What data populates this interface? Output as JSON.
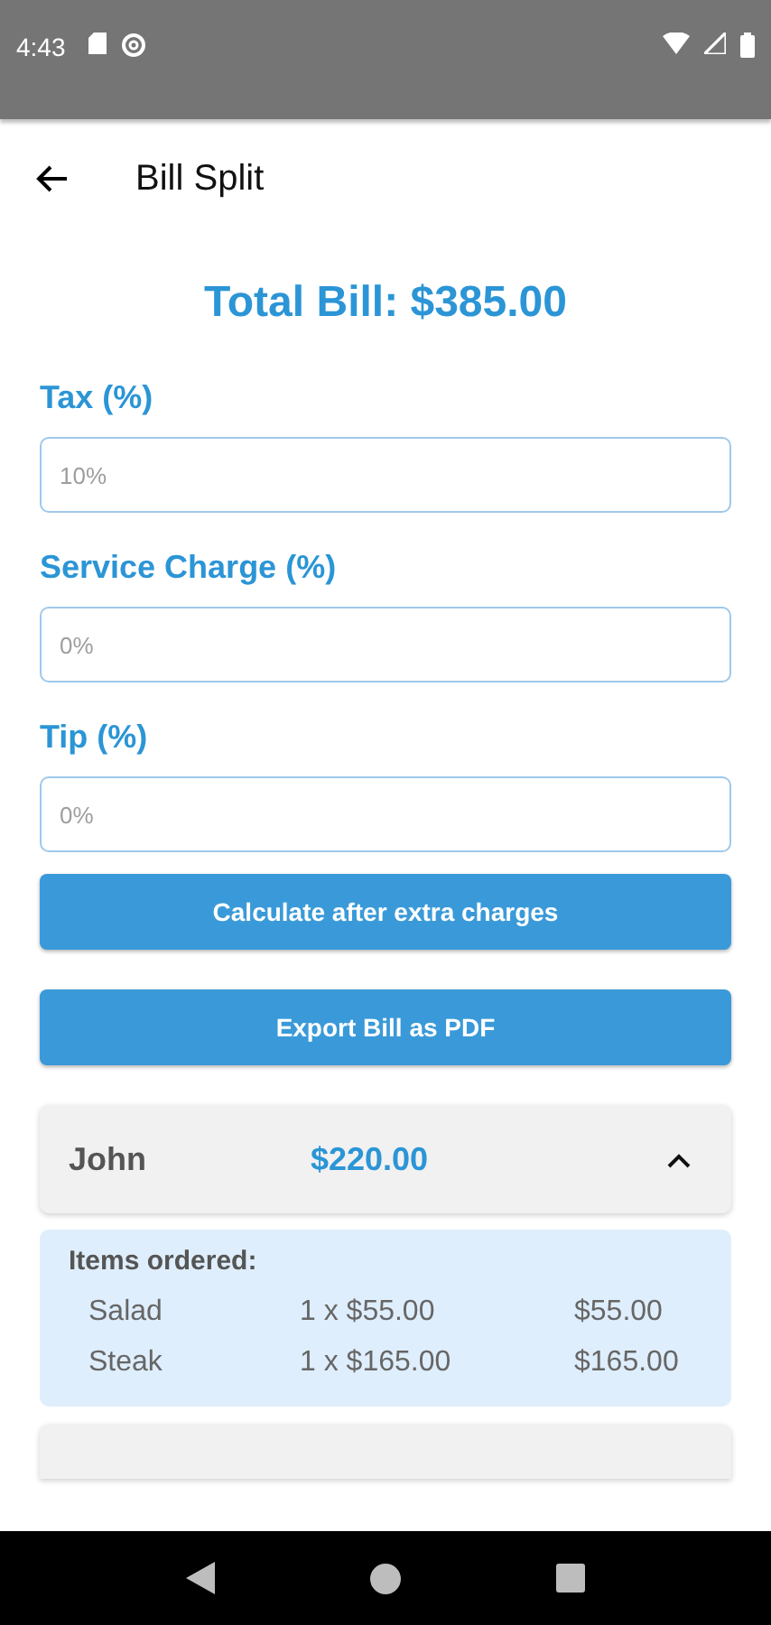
{
  "status_bar": {
    "time": "4:43"
  },
  "app_bar": {
    "title": "Bill Split"
  },
  "total": "Total Bill: $385.00",
  "fields": [
    {
      "label": "Tax (%)",
      "placeholder": "10%"
    },
    {
      "label": "Service Charge (%)",
      "placeholder": "0%"
    },
    {
      "label": "Tip (%)",
      "placeholder": "0%"
    }
  ],
  "buttons": [
    "Calculate after extra charges",
    "Export Bill as PDF"
  ],
  "people": [
    {
      "name": "John",
      "amount": "$220.00",
      "expanded": true,
      "items_heading": "Items ordered:",
      "items": [
        {
          "name": "Salad",
          "quantity": "1 x $55.00",
          "total": "$55.00"
        },
        {
          "name": "Steak",
          "quantity": "1 x $165.00",
          "total": "$165.00"
        }
      ]
    }
  ]
}
